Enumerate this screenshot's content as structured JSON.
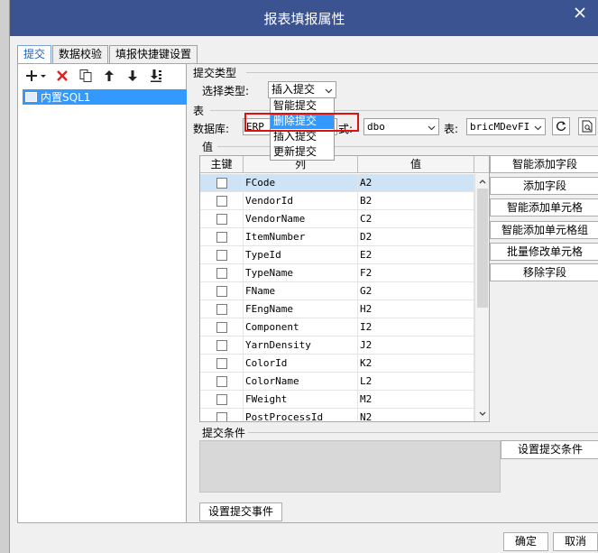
{
  "window": {
    "title": "报表填报属性"
  },
  "tabs": [
    {
      "label": "提交"
    },
    {
      "label": "数据校验"
    },
    {
      "label": "填报快捷键设置"
    }
  ],
  "left_panel": {
    "tree": [
      {
        "label": "内置SQL1"
      }
    ]
  },
  "submit_type": {
    "section_label": "提交类型",
    "select_label": "选择类型:",
    "select_value": "插入提交",
    "options": [
      "智能提交",
      "删除提交",
      "插入提交",
      "更新提交"
    ],
    "highlighted_option": "删除提交"
  },
  "table_section": {
    "section_label": "表",
    "db_label": "数据库:",
    "db_value": "ERP",
    "schema_partial": "式:",
    "schema_value": "dbo",
    "table_label": "表:",
    "table_value": "bricMDevFI"
  },
  "value_section": {
    "section_label": "值",
    "columns": [
      "主键",
      "列",
      "值"
    ],
    "rows": [
      {
        "col": "FCode",
        "val": "A2",
        "selected": true
      },
      {
        "col": "VendorId",
        "val": "B2"
      },
      {
        "col": "VendorName",
        "val": "C2"
      },
      {
        "col": "ItemNumber",
        "val": "D2"
      },
      {
        "col": "TypeId",
        "val": "E2"
      },
      {
        "col": "TypeName",
        "val": "F2"
      },
      {
        "col": "FName",
        "val": "G2"
      },
      {
        "col": "FEngName",
        "val": "H2"
      },
      {
        "col": "Component",
        "val": "I2"
      },
      {
        "col": "YarnDensity",
        "val": "J2"
      },
      {
        "col": "ColorId",
        "val": "K2"
      },
      {
        "col": "ColorName",
        "val": "L2"
      },
      {
        "col": "FWeight",
        "val": "M2"
      },
      {
        "col": "PostProcessId",
        "val": "N2"
      }
    ]
  },
  "side_buttons": [
    "智能添加字段",
    "添加字段",
    "智能添加单元格",
    "智能添加单元格组",
    "批量修改单元格",
    "移除字段"
  ],
  "condition": {
    "section_label": "提交条件",
    "button": "设置提交条件"
  },
  "event_button": "设置提交事件",
  "footer": {
    "ok": "确定",
    "cancel": "取消"
  },
  "colors": {
    "titlebar": "#3c5391",
    "selection": "#3399ff",
    "highlight_frame": "#e01010"
  }
}
